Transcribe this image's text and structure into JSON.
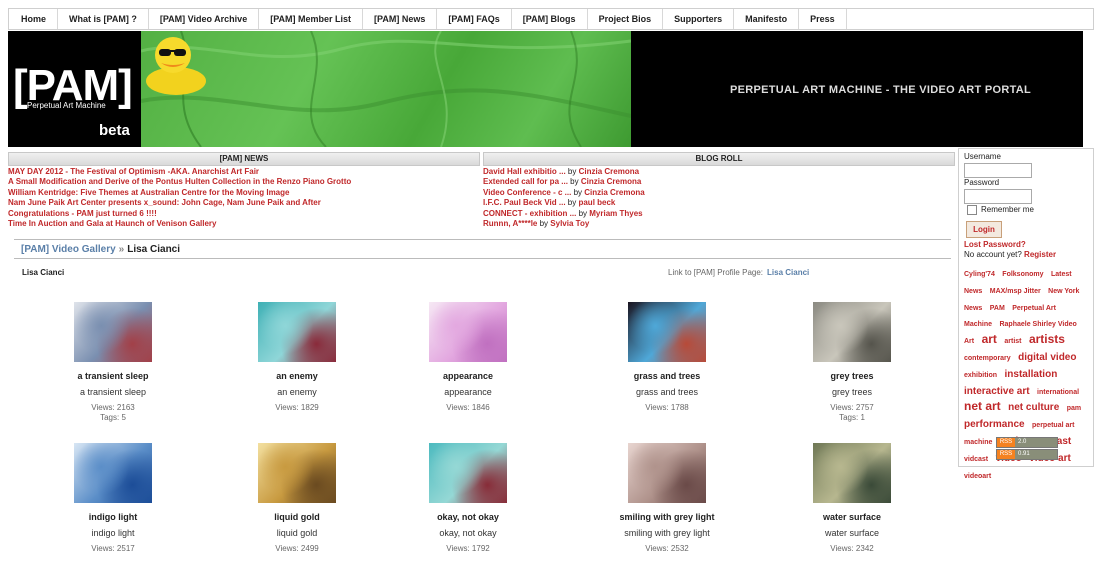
{
  "nav": [
    "Home",
    "What is [PAM] ?",
    "[PAM] Video Archive",
    "[PAM] Member List",
    "[PAM] News",
    "[PAM] FAQs",
    "[PAM] Blogs",
    "Project Bios",
    "Supporters",
    "Manifesto",
    "Press"
  ],
  "banner": {
    "logo": "[PAM]",
    "logo_sub": "Perpetual Art Machine",
    "beta": "beta",
    "title": "PERPETUAL ART MACHINE - THE VIDEO ART PORTAL"
  },
  "news": {
    "heading": "[PAM] NEWS",
    "items": [
      "MAY DAY 2012 - The Festival of Optimism -AKA. Anarchist Art Fair",
      "A Small Modification and Derive of the Pontus Hulten Collection in the Renzo Piano Grotto",
      "William Kentridge: Five Themes at Australian Centre for the Moving Image",
      "Nam June Paik Art Center presents x_sound: John Cage, Nam June Paik and After",
      "Congratulations - PAM just turned 6 !!!!",
      "Time In Auction and Gala at Haunch of Venison Gallery"
    ]
  },
  "blogroll": {
    "heading": "BLOG ROLL",
    "by": "by",
    "items": [
      {
        "title": "David Hall exhibitio ...",
        "author": "Cinzia Cremona"
      },
      {
        "title": "Extended call for pa ...",
        "author": "Cinzia Cremona"
      },
      {
        "title": "Video Conference - c ...",
        "author": "Cinzia Cremona"
      },
      {
        "title": "I.F.C. Paul Beck Vid ...",
        "author": "paul beck"
      },
      {
        "title": "CONNECT - exhibition ...",
        "author": "Myriam Thyes"
      },
      {
        "title": "Runnn, A****le",
        "author": "Sylvia Toy"
      }
    ]
  },
  "breadcrumb": {
    "root": "[PAM] Video Gallery",
    "sep": "»",
    "current": "Lisa Cianci"
  },
  "artist": "Lisa Cianci",
  "profile": {
    "label": "Link to [PAM] Profile Page:",
    "name": "Lisa Cianci"
  },
  "videos": [
    {
      "title": "a transient sleep",
      "desc": "a transient sleep",
      "views": "Views: 2163",
      "tags": "Tags: 5",
      "colors": [
        "#dfe3ea",
        "#7a8fb0",
        "#a24048"
      ]
    },
    {
      "title": "an enemy",
      "desc": "an enemy",
      "views": "Views: 1829",
      "tags": "",
      "colors": [
        "#3fb0b5",
        "#8fd6d8",
        "#8a2a3a"
      ]
    },
    {
      "title": "appearance",
      "desc": "appearance",
      "views": "Views: 1846",
      "tags": "",
      "colors": [
        "#f6e8f4",
        "#e3a8e0",
        "#c070c0"
      ]
    },
    {
      "title": "grass and trees",
      "desc": "grass and trees",
      "views": "Views: 1788",
      "tags": "",
      "colors": [
        "#1a1420",
        "#4fa8d8",
        "#b84a38"
      ]
    },
    {
      "title": "grey trees",
      "desc": "grey trees",
      "views": "Views: 2757",
      "tags": "Tags: 1",
      "colors": [
        "#8b8a82",
        "#c9c6bb",
        "#55544c"
      ]
    },
    {
      "title": "indigo light",
      "desc": "indigo light",
      "views": "Views: 2517",
      "tags": "",
      "colors": [
        "#d8e6f4",
        "#5b8ec8",
        "#1c4d98"
      ]
    },
    {
      "title": "liquid gold",
      "desc": "liquid gold",
      "views": "Views: 2499",
      "tags": "",
      "colors": [
        "#f3e0a0",
        "#c89a40",
        "#6a4a20"
      ]
    },
    {
      "title": "okay, not okay",
      "desc": "okay, not okay",
      "views": "Views: 1792",
      "tags": "",
      "colors": [
        "#4cbabf",
        "#95d8d5",
        "#882c38"
      ]
    },
    {
      "title": "smiling with grey light",
      "desc": "smiling with grey light",
      "views": "Views: 2532",
      "tags": "",
      "colors": [
        "#e8d5d0",
        "#b0938c",
        "#6a4a48"
      ]
    },
    {
      "title": "water surface",
      "desc": "water surface",
      "views": "Views: 2342",
      "tags": "",
      "colors": [
        "#6f7856",
        "#b7b78f",
        "#3a4a38"
      ]
    }
  ],
  "sidebar": {
    "username_label": "Username",
    "password_label": "Password",
    "remember": "Remember me",
    "login": "Login",
    "lost": "Lost Password?",
    "noaccount": "No account yet?",
    "register": "Register",
    "tags": [
      {
        "t": "Cyling'74",
        "s": 7
      },
      {
        "t": "Folksonomy",
        "s": 7
      },
      {
        "t": "Latest News",
        "s": 7
      },
      {
        "t": "MAX/msp Jitter",
        "s": 7
      },
      {
        "t": "New York News",
        "s": 7
      },
      {
        "t": "PAM",
        "s": 7
      },
      {
        "t": "Perpetual Art Machine",
        "s": 7
      },
      {
        "t": "Raphaele Shirley Video Art",
        "s": 7
      },
      {
        "t": "art",
        "s": 12
      },
      {
        "t": "artist",
        "s": 7
      },
      {
        "t": "artists",
        "s": 12
      },
      {
        "t": "contemporary",
        "s": 7
      },
      {
        "t": "digital video",
        "s": 10
      },
      {
        "t": "exhibition",
        "s": 7
      },
      {
        "t": "installation",
        "s": 10
      },
      {
        "t": "interactive art",
        "s": 10
      },
      {
        "t": "international",
        "s": 7
      },
      {
        "t": "net art",
        "s": 12
      },
      {
        "t": "net culture",
        "s": 10
      },
      {
        "t": "pam",
        "s": 7
      },
      {
        "t": "performance",
        "s": 10
      },
      {
        "t": "perpetual art machine",
        "s": 7
      },
      {
        "t": "podcast",
        "s": 10
      },
      {
        "t": "vcast",
        "s": 10
      },
      {
        "t": "vidcast",
        "s": 7
      },
      {
        "t": "video",
        "s": 10
      },
      {
        "t": "video art",
        "s": 10
      },
      {
        "t": "videoart",
        "s": 7
      }
    ],
    "rss": [
      {
        "a": "RSS",
        "b": "2.0"
      },
      {
        "a": "RSS",
        "b": "0.91"
      }
    ]
  },
  "colors": {
    "accent": "#c0282a",
    "link_blue": "#5a7fa8"
  }
}
